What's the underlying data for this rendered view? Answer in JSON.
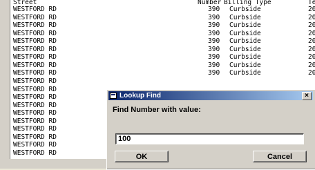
{
  "list": {
    "headers": {
      "street": "Street",
      "number": "Number",
      "billing": "Billing Type",
      "tail": "Te"
    },
    "rows": [
      {
        "street": "WESTFORD RD",
        "number": "390",
        "billing": "Curbside",
        "tail": "20"
      },
      {
        "street": "WESTFORD RD",
        "number": "390",
        "billing": "Curbside",
        "tail": "20"
      },
      {
        "street": "WESTFORD RD",
        "number": "390",
        "billing": "Curbside",
        "tail": "20"
      },
      {
        "street": "WESTFORD RD",
        "number": "390",
        "billing": "Curbside",
        "tail": "20"
      },
      {
        "street": "WESTFORD RD",
        "number": "390",
        "billing": "Curbside",
        "tail": "20"
      },
      {
        "street": "WESTFORD RD",
        "number": "390",
        "billing": "Curbside",
        "tail": "20"
      },
      {
        "street": "WESTFORD RD",
        "number": "390",
        "billing": "Curbside",
        "tail": "20"
      },
      {
        "street": "WESTFORD RD",
        "number": "390",
        "billing": "Curbside",
        "tail": "20"
      },
      {
        "street": "WESTFORD RD",
        "number": "390",
        "billing": "Curbside",
        "tail": "20"
      },
      {
        "street": "WESTFORD RD",
        "number": "",
        "billing": "",
        "tail": ""
      },
      {
        "street": "WESTFORD RD",
        "number": "",
        "billing": "",
        "tail": ""
      },
      {
        "street": "WESTFORD RD",
        "number": "",
        "billing": "",
        "tail": ""
      },
      {
        "street": "WESTFORD RD",
        "number": "",
        "billing": "",
        "tail": ""
      },
      {
        "street": "WESTFORD RD",
        "number": "",
        "billing": "",
        "tail": ""
      },
      {
        "street": "WESTFORD RD",
        "number": "",
        "billing": "",
        "tail": ""
      },
      {
        "street": "WESTFORD RD",
        "number": "",
        "billing": "",
        "tail": ""
      },
      {
        "street": "WESTFORD RD",
        "number": "",
        "billing": "",
        "tail": ""
      },
      {
        "street": "WESTFORD RD",
        "number": "",
        "billing": "",
        "tail": ""
      },
      {
        "street": "WESTFORD RD",
        "number": "",
        "billing": "",
        "tail": ""
      }
    ]
  },
  "dialog": {
    "title": "Lookup Find",
    "close_label": "×",
    "prompt": "Find Number with value:",
    "input_value": "100",
    "ok_label": "OK",
    "cancel_label": "Cancel"
  }
}
